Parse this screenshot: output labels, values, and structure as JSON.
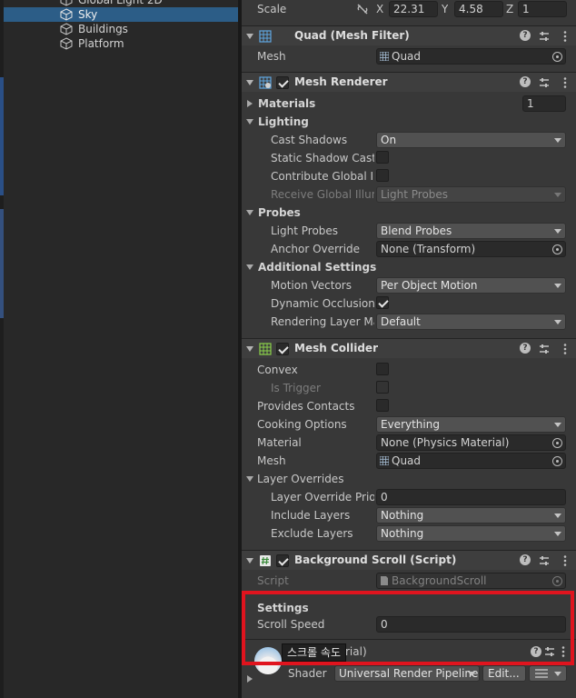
{
  "hierarchy": {
    "items": [
      {
        "label": "Global Light 2D"
      },
      {
        "label": "Sky",
        "selected": true
      },
      {
        "label": "Buildings"
      },
      {
        "label": "Platform"
      }
    ]
  },
  "transform": {
    "scale_label": "Scale",
    "x_label": "X",
    "x_value": "22.31",
    "y_label": "Y",
    "y_value": "4.58",
    "z_label": "Z",
    "z_value": "1"
  },
  "mesh_filter": {
    "title": "Quad (Mesh Filter)",
    "mesh_label": "Mesh",
    "mesh_value": "Quad"
  },
  "mesh_renderer": {
    "title": "Mesh Renderer",
    "materials_label": "Materials",
    "materials_count": "1",
    "lighting_label": "Lighting",
    "cast_shadows_label": "Cast Shadows",
    "cast_shadows_value": "On",
    "static_shadow_label": "Static Shadow Caster",
    "contribute_gi_label": "Contribute Global Illumination",
    "receive_gi_label": "Receive Global Illumination",
    "receive_gi_value": "Light Probes",
    "probes_label": "Probes",
    "light_probes_label": "Light Probes",
    "light_probes_value": "Blend Probes",
    "anchor_override_label": "Anchor Override",
    "anchor_override_value": "None (Transform)",
    "additional_label": "Additional Settings",
    "motion_vectors_label": "Motion Vectors",
    "motion_vectors_value": "Per Object Motion",
    "dynamic_occlusion_label": "Dynamic Occlusion",
    "rendering_layer_label": "Rendering Layer Mask",
    "rendering_layer_value": "Default"
  },
  "mesh_collider": {
    "title": "Mesh Collider",
    "convex_label": "Convex",
    "is_trigger_label": "Is Trigger",
    "provides_contacts_label": "Provides Contacts",
    "cooking_label": "Cooking Options",
    "cooking_value": "Everything",
    "material_label": "Material",
    "material_value": "None (Physics Material)",
    "mesh_label": "Mesh",
    "mesh_value": "Quad",
    "layer_overrides_label": "Layer Overrides",
    "layer_priority_label": "Layer Override Priority",
    "layer_priority_value": "0",
    "include_layers_label": "Include Layers",
    "include_layers_value": "Nothing",
    "exclude_layers_label": "Exclude Layers",
    "exclude_layers_value": "Nothing"
  },
  "background_scroll": {
    "title": "Background Scroll (Script)",
    "script_label": "Script",
    "script_value": "BackgroundScroll",
    "settings_label": "Settings",
    "scroll_speed_label": "Scroll Speed",
    "scroll_speed_value": "0"
  },
  "material": {
    "name_partial": "rial)",
    "tooltip": "스크롤 속도",
    "shader_label": "Shader",
    "shader_value": "Universal Render Pipeline",
    "edit_label": "Edit...",
    "list_icon": "list-icon"
  },
  "colors": {
    "highlight": "#e0141e",
    "selection": "#2c5d87",
    "collider_icon": "#8ad14a",
    "filter_icon": "#5fa7e0",
    "script_icon": "#4caf50"
  }
}
